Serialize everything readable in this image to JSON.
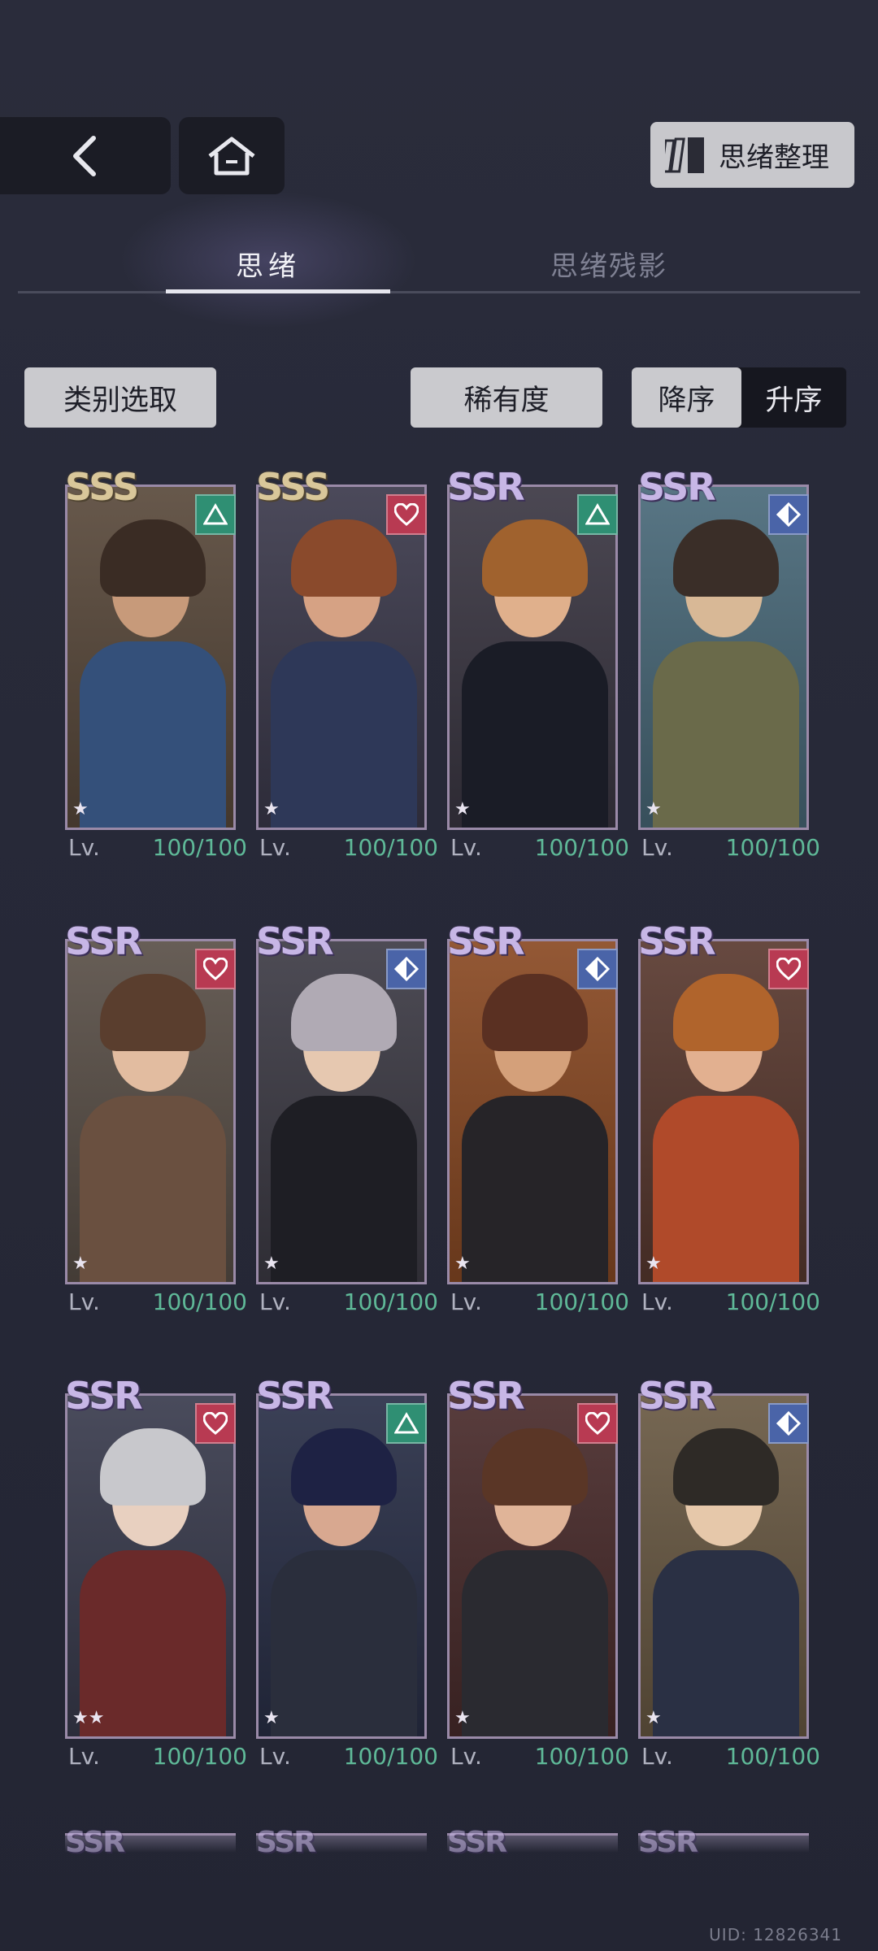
{
  "top_bar": {
    "organize_label": "思绪整理"
  },
  "tabs": [
    {
      "label": "思绪",
      "active": true
    },
    {
      "label": "思绪残影",
      "active": false
    }
  ],
  "filters": {
    "category_label": "类别选取",
    "rarity_label": "稀有度",
    "sort_desc_label": "降序",
    "sort_asc_label": "升序",
    "sort_selected": "降序"
  },
  "cards": [
    {
      "rank": "SSS",
      "badge": "triangle",
      "stars": "★",
      "lv_label": "Lv.",
      "level": "100/100"
    },
    {
      "rank": "SSS",
      "badge": "heart",
      "stars": "★",
      "lv_label": "Lv.",
      "level": "100/100"
    },
    {
      "rank": "SSR",
      "badge": "triangle",
      "stars": "★",
      "lv_label": "Lv.",
      "level": "100/100"
    },
    {
      "rank": "SSR",
      "badge": "diamond",
      "stars": "★",
      "lv_label": "Lv.",
      "level": "100/100"
    },
    {
      "rank": "SSR",
      "badge": "heart",
      "stars": "★",
      "lv_label": "Lv.",
      "level": "100/100"
    },
    {
      "rank": "SSR",
      "badge": "diamond",
      "stars": "★",
      "lv_label": "Lv.",
      "level": "100/100"
    },
    {
      "rank": "SSR",
      "badge": "diamond",
      "stars": "★",
      "lv_label": "Lv.",
      "level": "100/100"
    },
    {
      "rank": "SSR",
      "badge": "heart",
      "stars": "★",
      "lv_label": "Lv.",
      "level": "100/100"
    },
    {
      "rank": "SSR",
      "badge": "heart",
      "stars": "★★",
      "lv_label": "Lv.",
      "level": "100/100"
    },
    {
      "rank": "SSR",
      "badge": "triangle",
      "stars": "★",
      "lv_label": "Lv.",
      "level": "100/100"
    },
    {
      "rank": "SSR",
      "badge": "heart",
      "stars": "★",
      "lv_label": "Lv.",
      "level": "100/100"
    },
    {
      "rank": "SSR",
      "badge": "diamond",
      "stars": "★",
      "lv_label": "Lv.",
      "level": "100/100"
    }
  ],
  "partial_cards": [
    {
      "rank": "SSR"
    },
    {
      "rank": "SSR"
    },
    {
      "rank": "SSR"
    },
    {
      "rank": "SSR"
    }
  ],
  "footer": {
    "uid": "UID: 12826341"
  },
  "colors": {
    "background": "#262836",
    "level_value": "#5fb998",
    "badge_triangle": "#2f8f73",
    "badge_heart": "#b83a52",
    "badge_diamond": "#4a64a8"
  }
}
